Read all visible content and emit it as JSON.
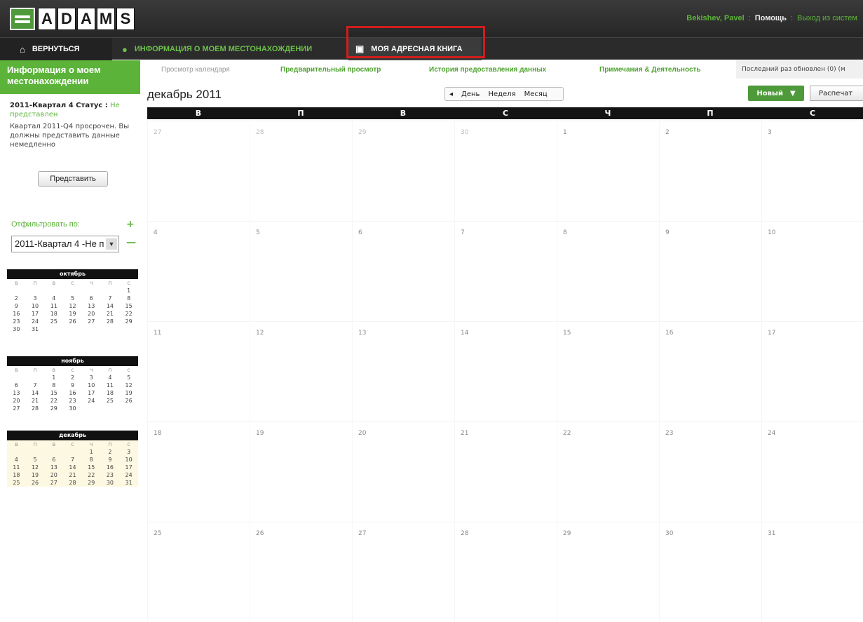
{
  "header": {
    "logo_letters": [
      "A",
      "D",
      "A",
      "M",
      "S"
    ],
    "user": "Bekishev, Pavel",
    "help": "Помощь",
    "logout": "Выход из систем",
    "separator": ":"
  },
  "nav": {
    "back": "ВЕРНУТЬСЯ",
    "location": "ИНФОРМАЦИЯ О МОЕМ МЕСТОНАХОЖДЕНИИ",
    "address_book": "МОЯ АДРЕСНАЯ КНИГА"
  },
  "sidebar": {
    "title": "Информация о моем местонахождении",
    "status_label": "2011-Квартал 4 Статус :",
    "status_value": "Не представлен",
    "status_desc": "Квартал 2011-Q4 просрочен. Вы должны представить данные немедленно",
    "submit": "Представить",
    "filter_label": "Отфильтровать по:",
    "filter_value": "2011-Квартал 4 -Не п"
  },
  "minicals": [
    {
      "name": "октябрь",
      "days": [
        "в",
        "п",
        "в",
        "с",
        "ч",
        "п",
        "с"
      ],
      "cells": [
        "",
        "",
        "",
        "",
        "",
        "",
        "1",
        "2",
        "3",
        "4",
        "5",
        "6",
        "7",
        "8",
        "9",
        "10",
        "11",
        "12",
        "13",
        "14",
        "15",
        "16",
        "17",
        "18",
        "19",
        "20",
        "21",
        "22",
        "23",
        "24",
        "25",
        "26",
        "27",
        "28",
        "29",
        "30",
        "31",
        "",
        "",
        "",
        "",
        ""
      ]
    },
    {
      "name": "ноябрь",
      "days": [
        "в",
        "п",
        "в",
        "с",
        "ч",
        "п",
        "с"
      ],
      "cells": [
        "",
        "",
        "1",
        "2",
        "3",
        "4",
        "5",
        "6",
        "7",
        "8",
        "9",
        "10",
        "11",
        "12",
        "13",
        "14",
        "15",
        "16",
        "17",
        "18",
        "19",
        "20",
        "21",
        "22",
        "23",
        "24",
        "25",
        "26",
        "27",
        "28",
        "29",
        "30",
        "",
        "",
        ""
      ]
    },
    {
      "name": "декабрь",
      "days": [
        "в",
        "п",
        "в",
        "с",
        "ч",
        "п",
        "с"
      ],
      "cells": [
        "",
        "",
        "",
        "",
        "1",
        "2",
        "3",
        "4",
        "5",
        "6",
        "7",
        "8",
        "9",
        "10",
        "11",
        "12",
        "13",
        "14",
        "15",
        "16",
        "17",
        "18",
        "19",
        "20",
        "21",
        "22",
        "23",
        "24",
        "25",
        "26",
        "27",
        "28",
        "29",
        "30",
        "31"
      ]
    }
  ],
  "tabs": {
    "calendar": "Просмотр календаря",
    "preview": "Предварительный просмотр",
    "history": "История предоставления данных",
    "notes": "Примечания & Деятельность"
  },
  "updated": "Последний раз обновлен (0) (м",
  "calendar": {
    "title": "декабрь 2011",
    "arrow": "◂",
    "day": "День",
    "week": "Неделя",
    "month": "Месяц",
    "new": "Новый",
    "print": "Распечат",
    "weekdays": [
      "В",
      "П",
      "В",
      "С",
      "Ч",
      "П",
      "С"
    ],
    "days": [
      "27",
      "28",
      "29",
      "30",
      "1",
      "2",
      "3",
      "4",
      "5",
      "6",
      "7",
      "8",
      "9",
      "10",
      "11",
      "12",
      "13",
      "14",
      "15",
      "16",
      "17",
      "18",
      "19",
      "20",
      "21",
      "22",
      "23",
      "24",
      "25",
      "26",
      "27",
      "28",
      "29",
      "30",
      "31"
    ],
    "other_month_count": 4
  },
  "colors": {
    "accent": "#5cb33a",
    "highlight": "#d21c1c",
    "header": "#262626"
  }
}
